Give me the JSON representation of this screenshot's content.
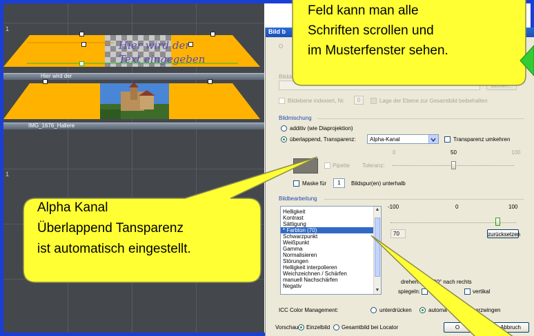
{
  "timeline": {
    "track_numbers": [
      "1",
      "1",
      "1"
    ],
    "clip1_title_lines": [
      "Hier wird der",
      "Text eingegeben"
    ],
    "bar1_label": "Hier wird der",
    "bar2_label": "IMG_1676_Hallere"
  },
  "dialog": {
    "title": "Bild b",
    "disabled": {
      "o_label": "O",
      "bilddatei_label": "Bilddatei",
      "suchen_button": "suchen...",
      "bildebene_label": "Bildebene indexiert, Nr.",
      "bildebene_value": "0",
      "lage_label": "Lage der Ebene zur Gesamtbild beibehalten"
    },
    "bildmischung": {
      "section": "Bildmischung",
      "additiv_label": "additiv (wie Diaprojektion)",
      "overlap_label": "überlappend, Transparenz:",
      "mode_value": "Alpha-Kanal",
      "transparenz_umkehren": "Transparenz umkehren",
      "slider_ticks": [
        "0",
        "50",
        "100"
      ],
      "pipette_label": "Pipette",
      "toleranz_label": "Toleranz:",
      "maske_label": "Maske für",
      "maske_value": "1",
      "bildspur_label": "Bildspur(en) unterhalb",
      "slider_value": 50
    },
    "bildbearbeitung": {
      "section": "Bildbearbeitung",
      "items": [
        "Helligkeit",
        "Kontrast",
        "Sättigung",
        "* Farbton (70)",
        "Schwarzpunkt",
        "Weißpunkt",
        "Gamma",
        "Normalisieren",
        "Störungen",
        "Helligkeit interpolieren",
        "Weichzeichnen / Schärfen",
        "manuell Nachschärfen",
        "Negativ"
      ],
      "selected_index": 3,
      "scale_ticks": [
        "-100",
        "0",
        "100"
      ],
      "value": "70",
      "slider_value": 70,
      "reset_button": "zurücksetzen",
      "drehen_label": "drehen:",
      "drehen_value": "90° nach rechts",
      "spiegeln_label": "spiegeln:",
      "vertikal_label": "vertikal"
    },
    "icc": {
      "label": "ICC Color Management:",
      "unterdruecken": "unterdrücken",
      "automatisch": "automa",
      "erzwingen": "erzwingen"
    },
    "vorschau": {
      "label": "Vorschau:",
      "einzelbild": "Einzelbild",
      "gesamtbild": "Gesamtbild bei Locator"
    },
    "ok_button": "O",
    "abbruch_button": "Abbruch"
  },
  "callouts": {
    "top_lines": [
      "Feld kann man alle",
      "Schriften scrollen und",
      "im Musterfenster sehen."
    ],
    "left_lines": [
      "Alpha Kanal",
      "Überlappend Tansparenz",
      "ist automatisch eingestellt."
    ]
  },
  "colors": {
    "frame_border": "#1a3fd6",
    "timeline_bg": "#44484d",
    "clip_orange": "#ffb300",
    "callout_fill": "#ffff33",
    "selection": "#316ac5",
    "accent_green": "#33cc33"
  }
}
